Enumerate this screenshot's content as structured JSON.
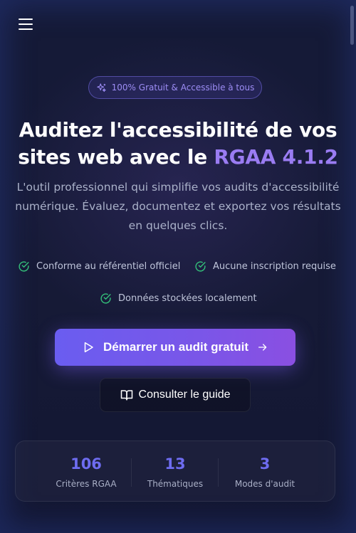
{
  "header": {
    "menu_icon": "hamburger-menu-icon"
  },
  "hero": {
    "badge": {
      "icon": "sparkles-icon",
      "label": "100% Gratuit & Accessible à tous"
    },
    "title_main": "Auditez l'accessibilité de vos sites web avec le ",
    "title_accent": "RGAA 4.1.2",
    "description": "L'outil professionnel qui simplifie vos audits d'accessibilité numérique. Évaluez, documentez et exportez vos résultats en quelques clics.",
    "features": [
      {
        "icon": "check-circle-icon",
        "label": "Conforme au référentiel officiel"
      },
      {
        "icon": "check-circle-icon",
        "label": "Aucune inscription requise"
      },
      {
        "icon": "check-circle-icon",
        "label": "Données stockées localement"
      }
    ],
    "primary_cta": {
      "icon": "play-icon",
      "label": "Démarrer un audit gratuit",
      "trailing_icon": "arrow-right-icon"
    },
    "secondary_cta": {
      "icon": "book-open-icon",
      "label": "Consulter le guide"
    }
  },
  "stats": [
    {
      "value": "106",
      "label": "Critères RGAA"
    },
    {
      "value": "13",
      "label": "Thématiques"
    },
    {
      "value": "3",
      "label": "Modes d'audit"
    }
  ],
  "colors": {
    "accent": "#9a7cf2",
    "primary_button": "#7458ec",
    "success": "#34c17a",
    "stat_value": "#6e6cf0",
    "background": "#151a37"
  }
}
